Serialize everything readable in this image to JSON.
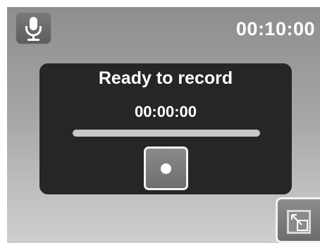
{
  "header": {
    "mic_icon": "microphone-icon",
    "time_remaining": "00:10:00"
  },
  "recorder": {
    "status": "Ready to record",
    "elapsed": "00:00:00",
    "progress": 0,
    "record_icon": "record-dot-icon"
  },
  "footer": {
    "exit_icon": "exit-arrow-icon"
  },
  "colors": {
    "panel": "#262626",
    "text": "#ffffff"
  }
}
